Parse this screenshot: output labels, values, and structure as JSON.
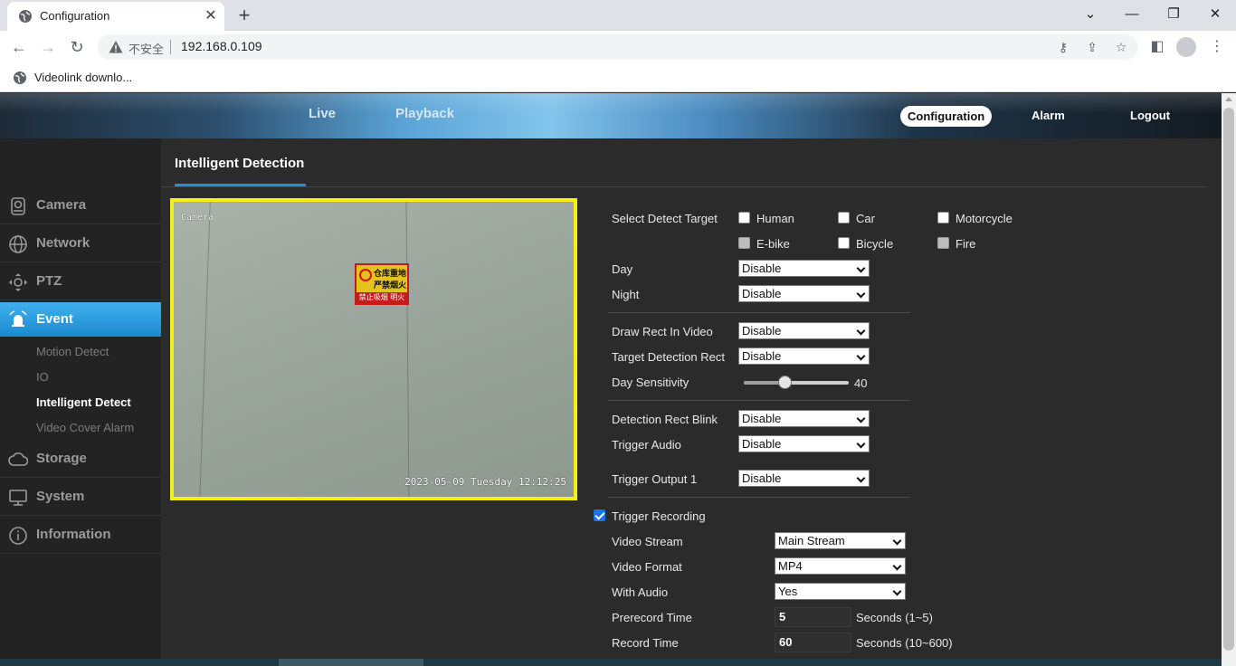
{
  "browser": {
    "tab_title": "Configuration",
    "tab_close": "✕",
    "new_tab": "+",
    "not_secure": "不安全",
    "url": "192.168.0.109",
    "bookmark": "Videolink downlo...",
    "window_controls": [
      "⌄",
      "—",
      "❐",
      "✕"
    ]
  },
  "header": {
    "live": "Live",
    "playback": "Playback",
    "configuration": "Configuration",
    "alarm": "Alarm",
    "logout": "Logout"
  },
  "sidebar": {
    "items": [
      {
        "label": "Camera",
        "icon": "camera-icon"
      },
      {
        "label": "Network",
        "icon": "globe-icon"
      },
      {
        "label": "PTZ",
        "icon": "ptz-icon"
      },
      {
        "label": "Event",
        "icon": "alarm-bell-icon"
      },
      {
        "label": "Storage",
        "icon": "storage-icon"
      },
      {
        "label": "System",
        "icon": "monitor-icon"
      },
      {
        "label": "Information",
        "icon": "info-icon"
      }
    ],
    "sub_items": [
      "Motion Detect",
      "IO",
      "Intelligent Detect",
      "Video Cover Alarm"
    ],
    "active_item": "Event",
    "active_sub_item": "Intelligent Detect",
    "accent_color": "#2a9ee2"
  },
  "content": {
    "tab": "Intelligent Detection"
  },
  "video": {
    "osd_title": "Camera",
    "osd_time": "2023-05-09 Tuesday 12:12:25",
    "sign_line1": "仓库重地",
    "sign_line2": "严禁烟火",
    "sign_line3": "禁止吸烟 明火",
    "border_color": "#f4ef16"
  },
  "form": {
    "detect_target_label": "Select Detect Target",
    "targets": [
      {
        "label": "Human",
        "checked": false,
        "enabled": true
      },
      {
        "label": "Car",
        "checked": false,
        "enabled": true
      },
      {
        "label": "Motorcycle",
        "checked": false,
        "enabled": true
      },
      {
        "label": "E-bike",
        "checked": false,
        "enabled": false
      },
      {
        "label": "Bicycle",
        "checked": false,
        "enabled": true
      },
      {
        "label": "Fire",
        "checked": false,
        "enabled": false
      }
    ],
    "day_label": "Day",
    "day_value": "Disable",
    "night_label": "Night",
    "night_value": "Disable",
    "draw_rect_label": "Draw Rect In Video",
    "draw_rect_value": "Disable",
    "target_rect_label": "Target Detection Rect",
    "target_rect_value": "Disable",
    "day_sensitivity_label": "Day Sensitivity",
    "day_sensitivity_value": "40",
    "day_sensitivity_fraction": 0.4,
    "rect_blink_label": "Detection Rect Blink",
    "rect_blink_value": "Disable",
    "trigger_audio_label": "Trigger Audio",
    "trigger_audio_value": "Disable",
    "trigger_output_label": "Trigger Output 1",
    "trigger_output_value": "Disable",
    "trigger_recording_label": "Trigger Recording",
    "trigger_recording_checked": true,
    "video_stream_label": "Video Stream",
    "video_stream_value": "Main Stream",
    "video_format_label": "Video Format",
    "video_format_value": "MP4",
    "with_audio_label": "With Audio",
    "with_audio_value": "Yes",
    "prerecord_label": "Prerecord Time",
    "prerecord_value": "5",
    "prerecord_unit": "Seconds (1~5)",
    "record_time_label": "Record Time",
    "record_time_value": "60",
    "record_time_unit": "Seconds (10~600)"
  }
}
